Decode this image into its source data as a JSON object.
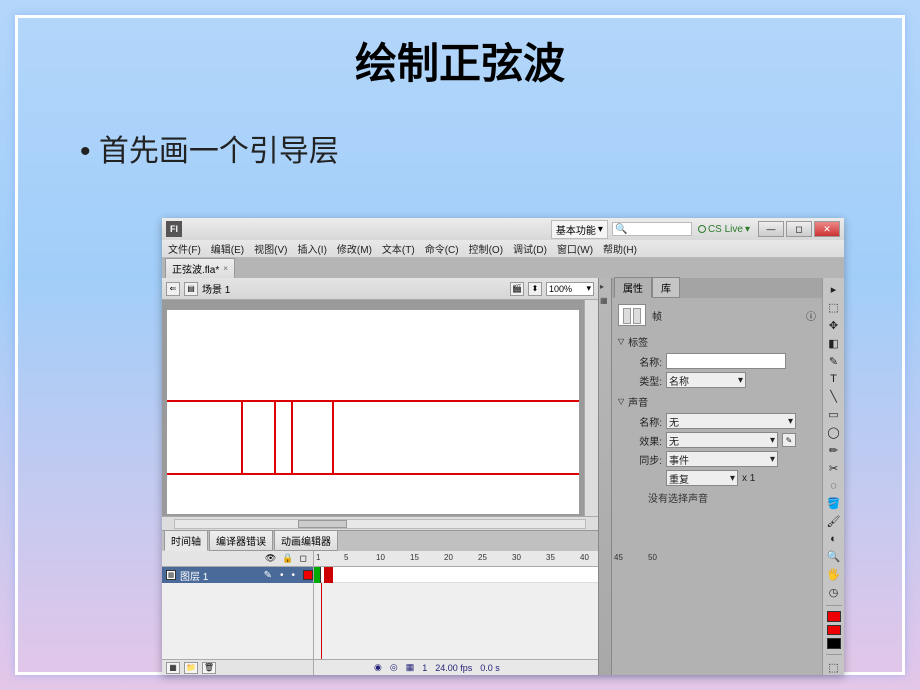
{
  "slide": {
    "title": "绘制正弦波",
    "bullet": "首先画一个引导层"
  },
  "titlebar": {
    "workspace": "基本功能",
    "search_placeholder": "🔍",
    "cslive": "CS Live"
  },
  "menus": [
    "文件(F)",
    "编辑(E)",
    "视图(V)",
    "插入(I)",
    "修改(M)",
    "文本(T)",
    "命令(C)",
    "控制(O)",
    "调试(D)",
    "窗口(W)",
    "帮助(H)"
  ],
  "doc_tab": {
    "name": "正弦波.fla*",
    "close": "×"
  },
  "scene": {
    "label": "场景 1",
    "zoom": "100%"
  },
  "timeline": {
    "tabs": [
      "时间轴",
      "编译器错误",
      "动画编辑器"
    ],
    "layer": "图层 1",
    "ruler": [
      1,
      5,
      10,
      15,
      20,
      25,
      30,
      35,
      40,
      45,
      50
    ],
    "status": {
      "frame": "1",
      "fps": "24.00 fps",
      "time": "0.0 s"
    },
    "head_icons": [
      "👁",
      "🔒",
      "◻"
    ]
  },
  "panel": {
    "tabs": [
      "属性",
      "库"
    ],
    "type": "帧",
    "sections": {
      "label_title": "标签",
      "name_label": "名称:",
      "type_label": "类型:",
      "type_value": "名称",
      "sound_title": "声音",
      "sound_name_label": "名称:",
      "sound_name_value": "无",
      "effect_label": "效果:",
      "effect_value": "无",
      "sync_label": "同步:",
      "sync_value": "事件",
      "repeat_value": "重复",
      "repeat_count": "x 1",
      "note": "没有选择声音"
    }
  },
  "tools": [
    "▸",
    "⬚",
    "✥",
    "◧",
    "✎",
    "T",
    "╲",
    "▭",
    "◯",
    "✏",
    "✂",
    "◌",
    "🪣",
    "🖌",
    "◐",
    "🔍",
    "🖐",
    "◷"
  ]
}
